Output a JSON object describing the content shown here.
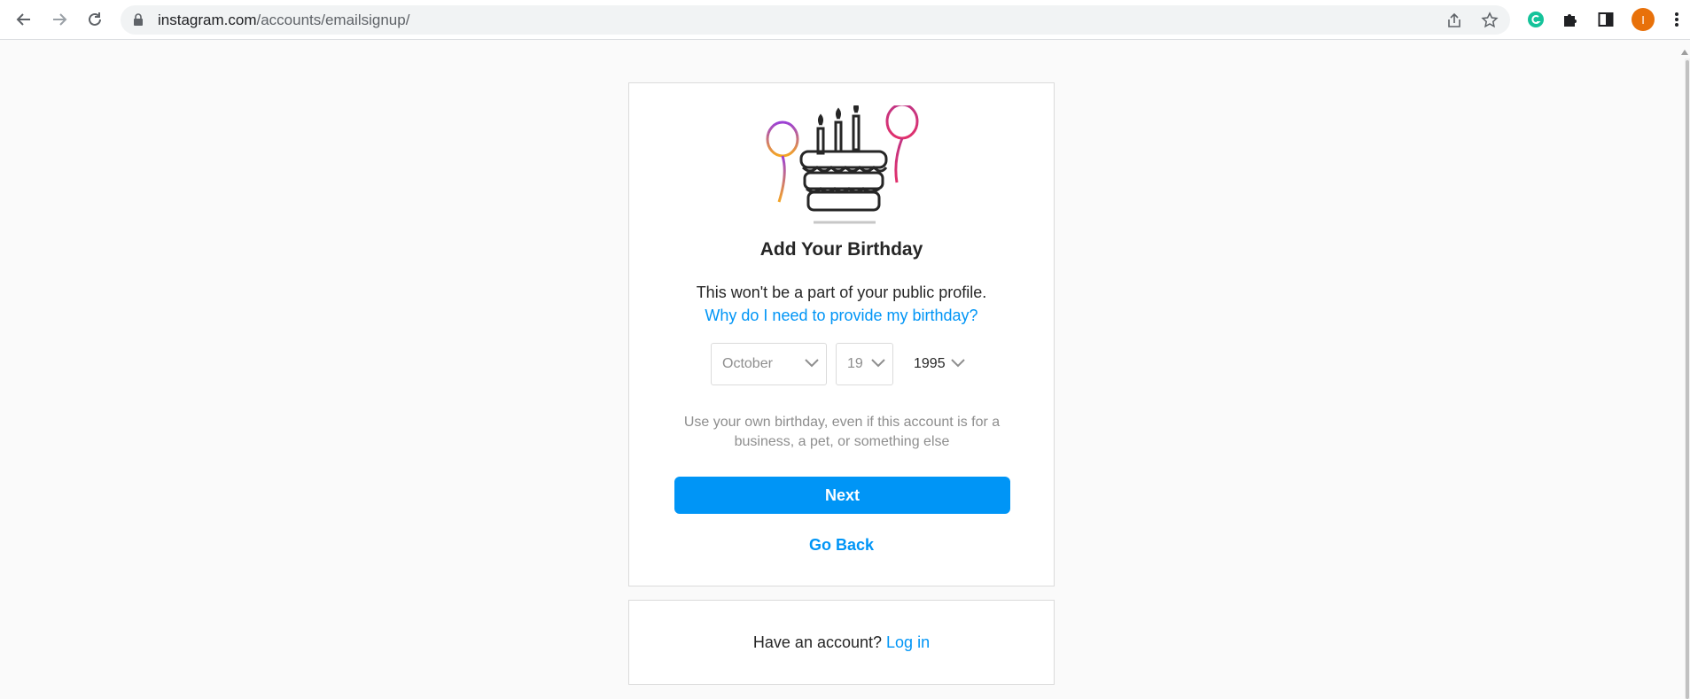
{
  "browser": {
    "url_host": "instagram.com",
    "url_path": "/accounts/emailsignup/",
    "profile_initial": "I"
  },
  "card": {
    "title": "Add Your Birthday",
    "subtitle": "This won't be a part of your public profile.",
    "why_link": "Why do I need to provide my birthday?",
    "month": "October",
    "day": "19",
    "year": "1995",
    "hint": "Use your own birthday, even if this account is for a business, a pet, or something else",
    "next_label": "Next",
    "back_label": "Go Back"
  },
  "login": {
    "prompt": "Have an account?",
    "link": "Log in"
  },
  "colors": {
    "accent": "#0095f6",
    "text": "#262626",
    "muted": "#8e8e8e",
    "border": "#dbdbdb",
    "background": "#fafafa"
  }
}
